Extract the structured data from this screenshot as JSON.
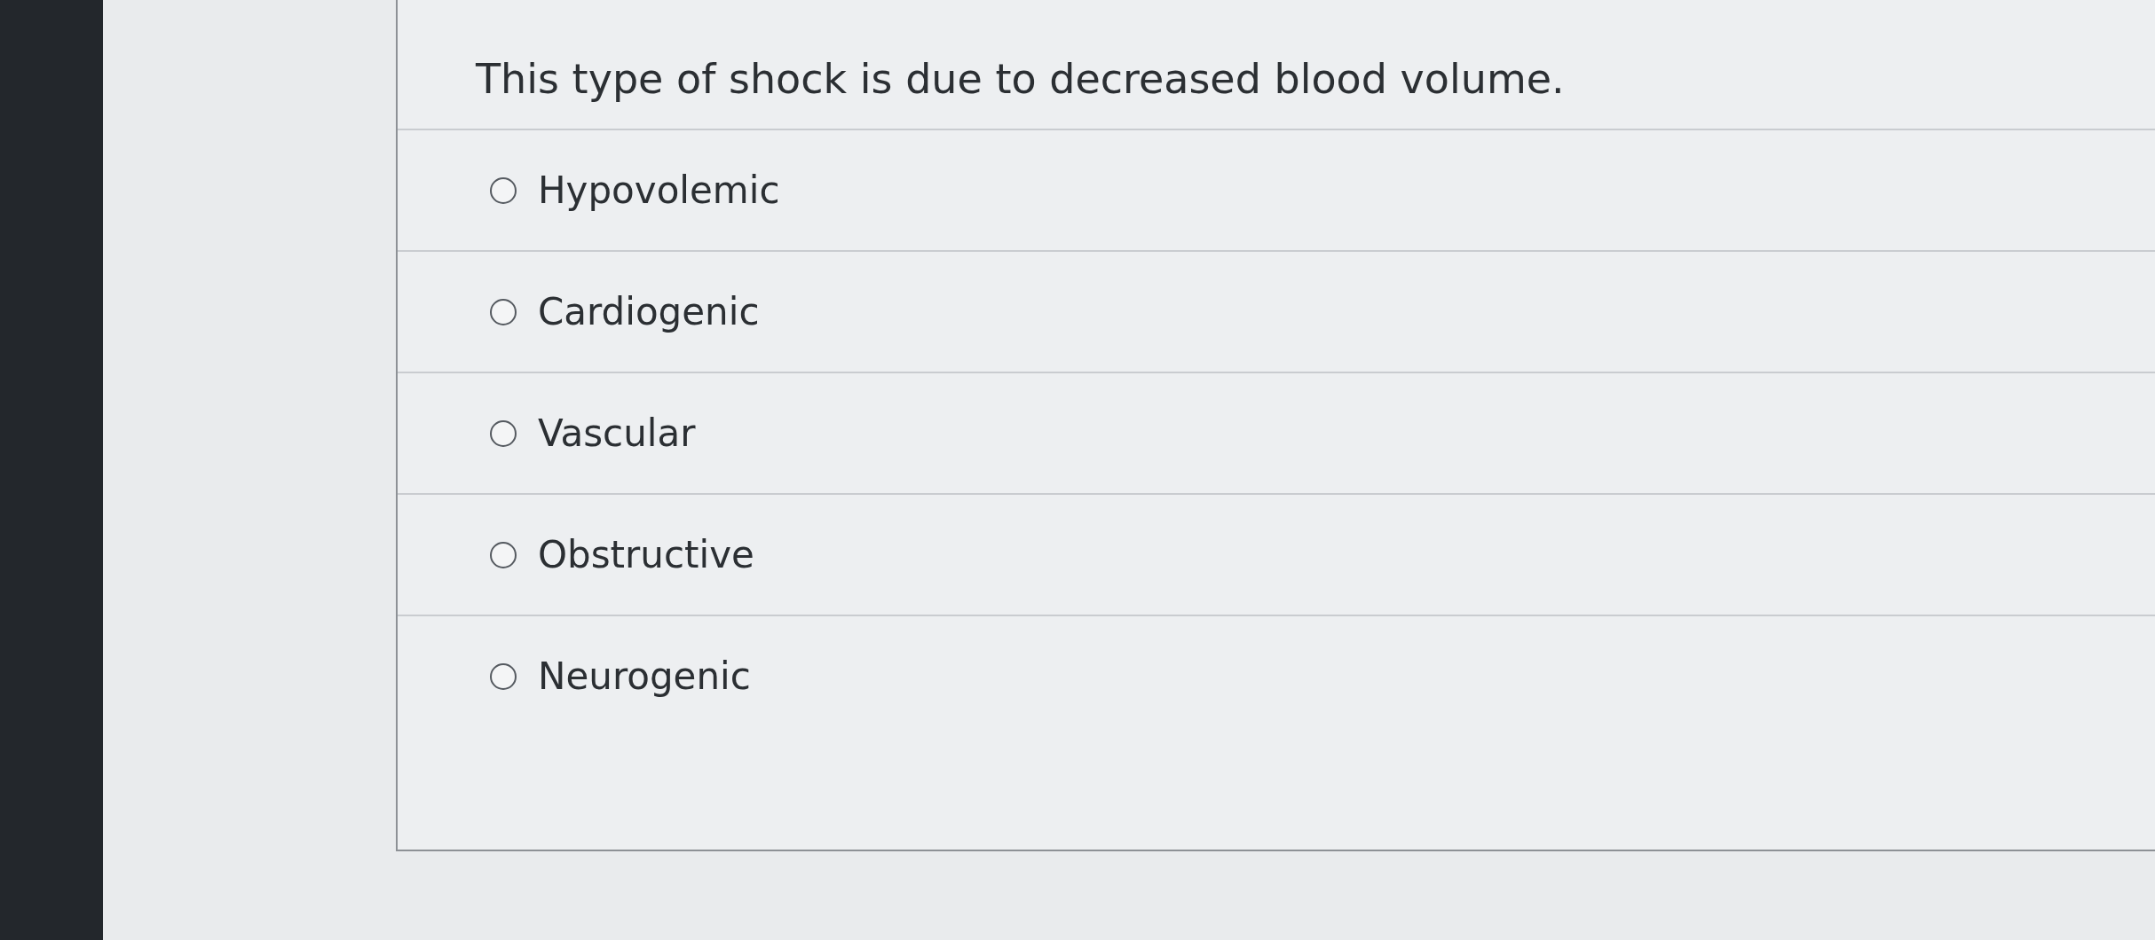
{
  "question": {
    "text": "This type of shock is due to decreased blood volume."
  },
  "options": [
    {
      "label": "Hypovolemic",
      "selected": false
    },
    {
      "label": "Cardiogenic",
      "selected": false
    },
    {
      "label": "Vascular",
      "selected": false
    },
    {
      "label": "Obstructive",
      "selected": false
    },
    {
      "label": "Neurogenic",
      "selected": false
    }
  ]
}
